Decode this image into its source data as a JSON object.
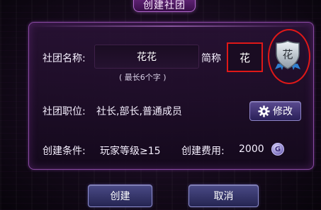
{
  "dialog": {
    "title": "创建社团",
    "name_label": "社团名称:",
    "name_value": "花花",
    "name_hint": "( 最长6个字 )",
    "abbr_label": "简称",
    "abbr_value": "花",
    "emblem_text": "花",
    "positions_label": "社团职位:",
    "positions_value": "社长,部长,普通成员",
    "modify_label": "修改",
    "condition_label": "创建条件:",
    "condition_value": "玩家等级≥15",
    "cost_label": "创建费用:",
    "cost_value": "2000",
    "currency_icon": "G",
    "create_button": "创建",
    "cancel_button": "取消"
  },
  "colors": {
    "highlight": "#e01818",
    "panel_border": "#8a4aa3",
    "button": "#4a4a86"
  },
  "icons": {
    "modify": "gear-icon",
    "currency": "coin-icon",
    "emblem": "shield-emblem-icon"
  }
}
